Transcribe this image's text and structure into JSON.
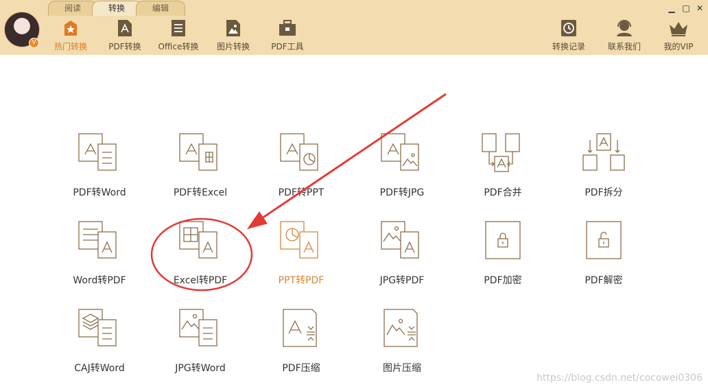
{
  "header": {
    "tabs": [
      {
        "label": "阅读",
        "active": false
      },
      {
        "label": "转换",
        "active": true
      },
      {
        "label": "编辑",
        "active": false
      }
    ],
    "avatar_badge": "V",
    "toolbar": [
      {
        "label": "热门转换",
        "icon": "star-icon",
        "active": true
      },
      {
        "label": "PDF转换",
        "icon": "pdf-file-icon",
        "active": false
      },
      {
        "label": "Office转换",
        "icon": "office-doc-icon",
        "active": false
      },
      {
        "label": "图片转换",
        "icon": "image-file-icon",
        "active": false
      },
      {
        "label": "PDF工具",
        "icon": "toolbox-icon",
        "active": false
      }
    ],
    "right_toolbar": [
      {
        "label": "转换记录",
        "icon": "clock-icon"
      },
      {
        "label": "联系我们",
        "icon": "headset-icon"
      },
      {
        "label": "我的VIP",
        "icon": "crown-icon"
      }
    ],
    "window_controls": {
      "minimize": "▁",
      "maximize": "□",
      "close": "✕"
    },
    "colors": {
      "header_bg": "#f2dcb0",
      "accent": "#e07a22",
      "line": "#8b6e4c",
      "annotation": "#e53935"
    }
  },
  "tiles": [
    {
      "label": "PDF转Word",
      "icon": "pdf-to-word-icon"
    },
    {
      "label": "PDF转Excel",
      "icon": "pdf-to-excel-icon"
    },
    {
      "label": "PDF转PPT",
      "icon": "pdf-to-ppt-icon"
    },
    {
      "label": "PDF转JPG",
      "icon": "pdf-to-jpg-icon"
    },
    {
      "label": "PDF合并",
      "icon": "pdf-merge-icon"
    },
    {
      "label": "PDF拆分",
      "icon": "pdf-split-icon"
    },
    {
      "label": "Word转PDF",
      "icon": "word-to-pdf-icon"
    },
    {
      "label": "Excel转PDF",
      "icon": "excel-to-pdf-icon"
    },
    {
      "label": "PPT转PDF",
      "icon": "ppt-to-pdf-icon",
      "highlight": true
    },
    {
      "label": "JPG转PDF",
      "icon": "jpg-to-pdf-icon"
    },
    {
      "label": "PDF加密",
      "icon": "pdf-encrypt-icon"
    },
    {
      "label": "PDF解密",
      "icon": "pdf-decrypt-icon"
    },
    {
      "label": "CAJ转Word",
      "icon": "caj-to-word-icon"
    },
    {
      "label": "JPG转Word",
      "icon": "jpg-to-word-icon"
    },
    {
      "label": "PDF压缩",
      "icon": "pdf-compress-icon"
    },
    {
      "label": "图片压缩",
      "icon": "image-compress-icon"
    }
  ],
  "watermark": "https://blog.csdn.net/cocowei0306"
}
